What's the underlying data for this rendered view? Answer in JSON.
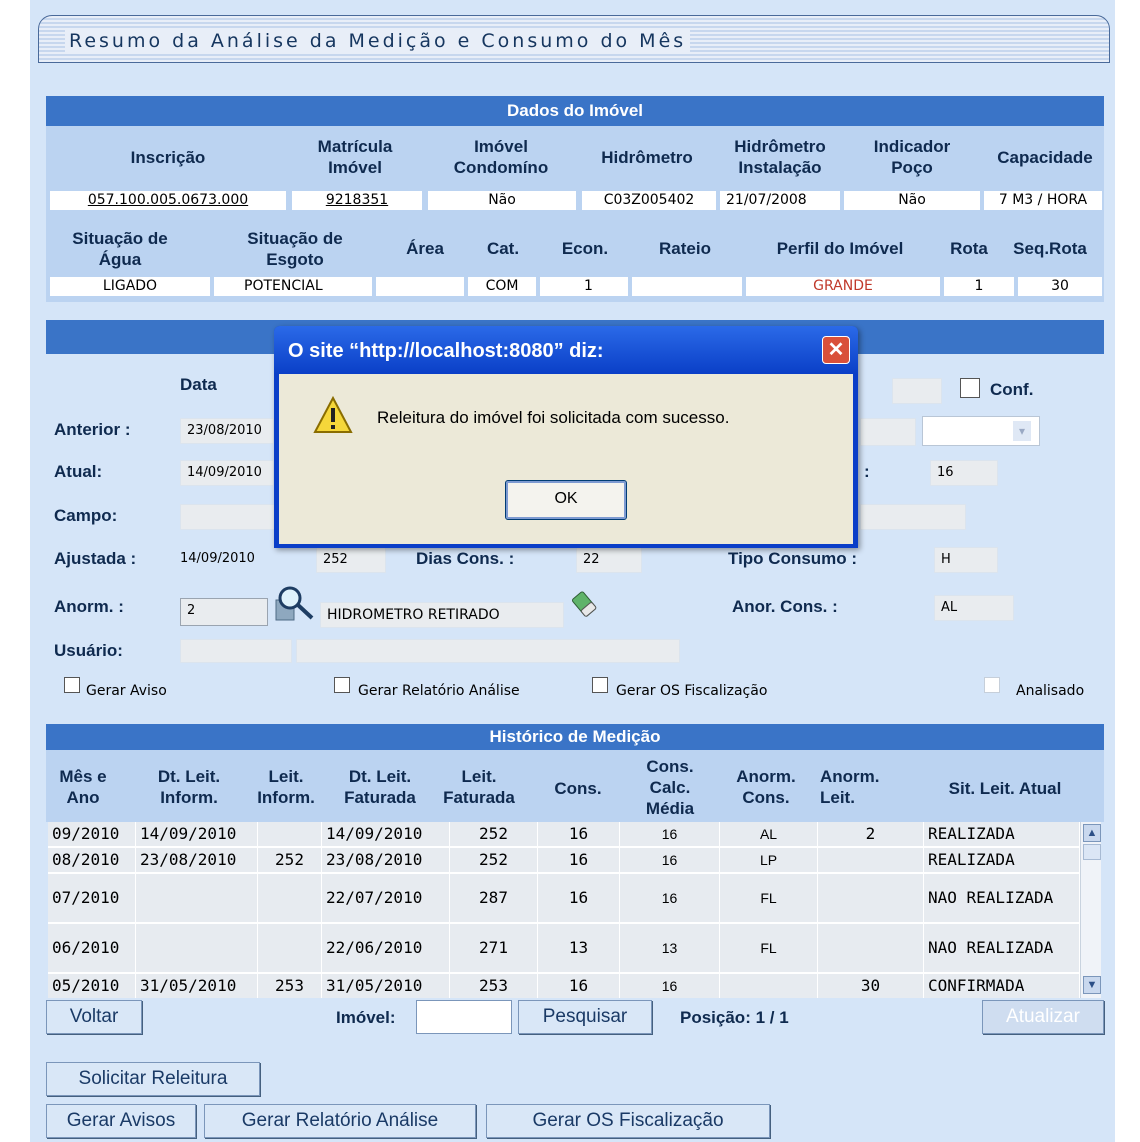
{
  "page_title": "Resumo da Análise da Medição e Consumo do Mês",
  "imovel": {
    "section_title": "Dados do Imóvel",
    "headers1": [
      "Inscrição",
      "Matrícula Imóvel",
      "Imóvel Condomíno",
      "Hidrômetro",
      "Hidrômetro Instalação",
      "Indicador Poço",
      "Capacidade"
    ],
    "values1": {
      "inscricao": "057.100.005.0673.000",
      "matricula": "9218351",
      "condominio": "Não",
      "hidrometro": "C03Z005402",
      "instalacao": "21/07/2008",
      "poco": "Não",
      "capacidade": "7 M3 / HORA"
    },
    "headers2": [
      "Situação de Água",
      "Situação de Esgoto",
      "Área",
      "Cat.",
      "Econ.",
      "Rateio",
      "Perfil do Imóvel",
      "Rota",
      "Seq.Rota"
    ],
    "values2": {
      "agua": "LIGADO",
      "esgoto": "POTENCIAL",
      "area": "",
      "cat": "COM",
      "econ": "1",
      "rateio": "",
      "perfil": "GRANDE",
      "rota": "1",
      "seq": "30"
    }
  },
  "medicao": {
    "col_data": "Data",
    "conf_label": "Conf.",
    "anterior_label": "Anterior :",
    "anterior_data": "23/08/2010",
    "atual_label": "Atual:",
    "atual_data": "14/09/2010",
    "atual_right": "16",
    "campo_label": "Campo:",
    "ajustada_label": "Ajustada :",
    "ajustada_data": "14/09/2010",
    "ajustada_leit": "252",
    "dias_label": "Dias Cons. :",
    "dias_value": "22",
    "tipo_label": "Tipo Consumo :",
    "tipo_value": "H",
    "anorm_label": "Anorm. :",
    "anorm_value": "2",
    "anorm_desc": "HIDROMETRO RETIRADO",
    "anor_cons_label": "Anor. Cons. :",
    "anor_cons_value": "AL",
    "usuario_label": "Usuário:",
    "gerar_aviso": "Gerar Aviso",
    "gerar_relatorio": "Gerar Relatório Análise",
    "gerar_os": "Gerar OS Fiscalização",
    "analisado": "Analisado"
  },
  "historico": {
    "section_title": "Histórico de Medição",
    "headers": [
      "Mês e Ano",
      "Dt. Leit. Inform.",
      "Leit. Inform.",
      "Dt. Leit. Faturada",
      "Leit. Faturada",
      "Cons.",
      "Cons. Calc. Média",
      "Anorm. Cons.",
      "Anorm. Leit.",
      "Sit. Leit. Atual"
    ],
    "rows": [
      [
        "09/2010",
        "14/09/2010",
        "",
        "14/09/2010",
        "252",
        "16",
        "16",
        "AL",
        "2",
        "REALIZADA"
      ],
      [
        "08/2010",
        "23/08/2010",
        "252",
        "23/08/2010",
        "252",
        "16",
        "16",
        "LP",
        "",
        "REALIZADA"
      ],
      [
        "07/2010",
        "",
        "",
        "22/07/2010",
        "287",
        "16",
        "16",
        "FL",
        "",
        "NAO REALIZADA"
      ],
      [
        "06/2010",
        "",
        "",
        "22/06/2010",
        "271",
        "13",
        "13",
        "FL",
        "",
        "NAO REALIZADA"
      ],
      [
        "05/2010",
        "31/05/2010",
        "253",
        "31/05/2010",
        "253",
        "16",
        "16",
        "",
        "30",
        "CONFIRMADA"
      ]
    ]
  },
  "footer": {
    "voltar": "Voltar",
    "imovel_label": "Imóvel:",
    "imovel_value": "",
    "pesquisar": "Pesquisar",
    "posicao": "Posição: 1 / 1",
    "atualizar": "Atualizar",
    "solicitar": "Solicitar Releitura",
    "gerar_avisos": "Gerar Avisos",
    "gerar_relatorio": "Gerar Relatório Análise",
    "gerar_os": "Gerar OS Fiscalização"
  },
  "dialog": {
    "title": "O site “http://localhost:8080” diz:",
    "message": "Releitura do imóvel foi solicitada com sucesso.",
    "ok": "OK"
  },
  "colors": {
    "header_blue": "#3a74c7",
    "panel": "#d5e5f8",
    "perfil_red": "#c0392b",
    "dialog_blue": "#0a3ec8"
  }
}
